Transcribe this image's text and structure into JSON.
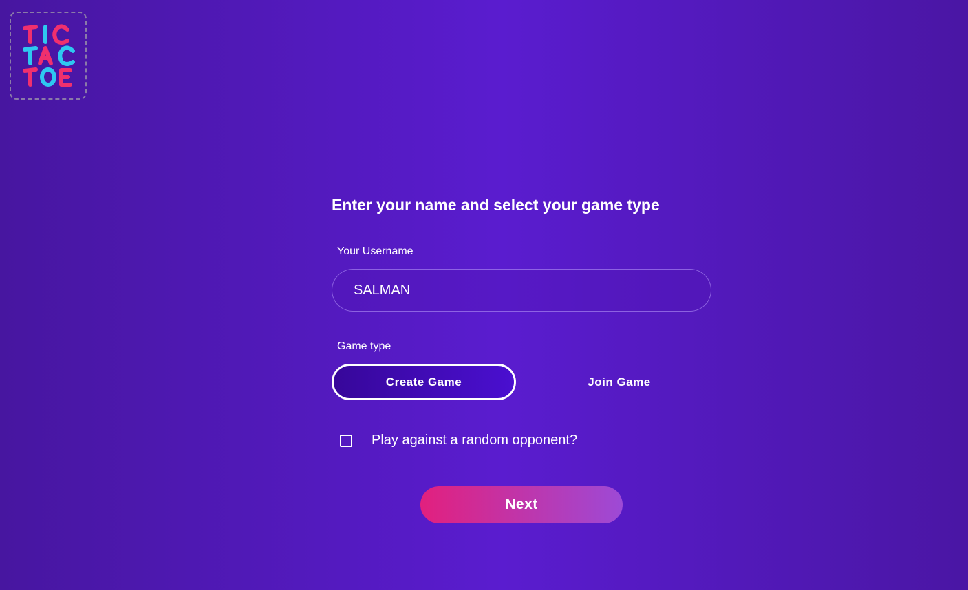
{
  "logo": {
    "lines": [
      "TIC",
      "TAC",
      "TOE"
    ],
    "colors": {
      "pink": "#f0306e",
      "cyan": "#2ec8f0"
    }
  },
  "form": {
    "heading": "Enter your name and select your game type",
    "username_label": "Your Username",
    "username_value": "SALMAN",
    "game_type_label": "Game type",
    "game_types": [
      {
        "label": "Create Game",
        "selected": true
      },
      {
        "label": "Join Game",
        "selected": false
      }
    ],
    "random_opponent_label": "Play against a random opponent?",
    "random_opponent_checked": false,
    "next_label": "Next"
  },
  "colors": {
    "background": "#5a1ccf",
    "next_gradient_start": "#e2207e",
    "next_gradient_end": "#9d4ad6",
    "selected_button": "#4a0fd0"
  }
}
